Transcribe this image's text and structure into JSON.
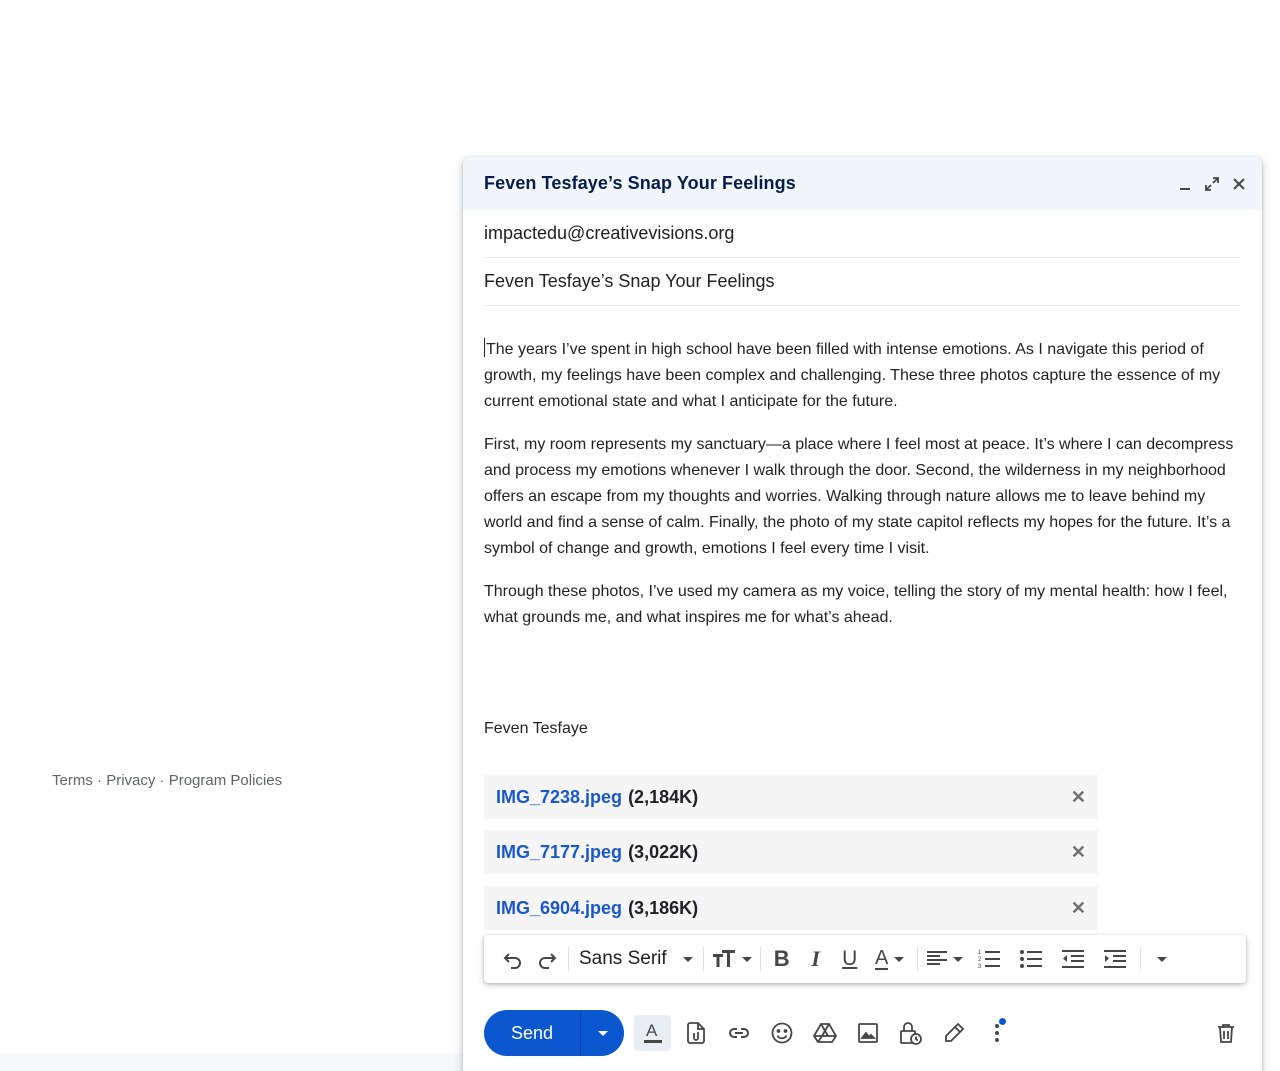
{
  "footer": {
    "terms": "Terms",
    "privacy": "Privacy",
    "program_policies": "Program Policies",
    "separator": " · "
  },
  "compose": {
    "title": "Feven Tesfaye’s Snap Your Feelings",
    "to": "impactedu@creativevisions.org",
    "subject": "Feven Tesfaye’s Snap Your Feelings",
    "paragraphs": [
      "The years I’ve spent in high school have been filled with intense emotions. As I navigate this period of growth, my feelings have been complex and challenging. These three photos capture the essence of my current emotional state and what I anticipate for the future.",
      "First, my room represents my sanctuary—a place where I feel most at peace. It’s where I can decompress and process my emotions whenever I walk through the door. Second, the wilderness in my neighborhood offers an escape from my thoughts and worries. Walking through nature allows me to leave behind my world and find a sense of calm. Finally, the photo of my state capitol reflects my hopes for the future. It’s a symbol of change and growth, emotions I feel every time I visit.",
      "Through these photos, I’ve used my camera as my voice, telling the story of my mental health: how I feel, what grounds me, and what inspires me for what’s ahead."
    ],
    "signature": "Feven Tesfaye",
    "attachments": [
      {
        "name": "IMG_7238.jpeg",
        "size": "(2,184K)"
      },
      {
        "name": "IMG_7177.jpeg",
        "size": "(3,022K)"
      },
      {
        "name": "IMG_6904.jpeg",
        "size": "(3,186K)"
      }
    ],
    "formatting": {
      "font": "Sans Serif"
    },
    "send_label": "Send",
    "icons": {
      "header": [
        "minimize-icon",
        "expand-icon",
        "close-icon"
      ],
      "format_bar": [
        "undo-icon",
        "redo-icon",
        "text-size-icon",
        "bold-icon",
        "italic-icon",
        "underline-icon",
        "text-color-icon",
        "align-icon",
        "numbered-list-icon",
        "bulleted-list-icon",
        "indent-less-icon",
        "indent-more-icon",
        "more-formatting-icon"
      ],
      "bottom_bar": [
        "formatting-options-icon",
        "attach-file-icon",
        "insert-link-icon",
        "emoji-icon",
        "drive-icon",
        "insert-photo-icon",
        "confidential-mode-icon",
        "signature-icon",
        "more-options-icon",
        "discard-draft-icon"
      ]
    },
    "colors": {
      "accent": "#0b57d0",
      "header_bg": "#f2f6fc",
      "attachment_link": "#1a57c8"
    }
  }
}
